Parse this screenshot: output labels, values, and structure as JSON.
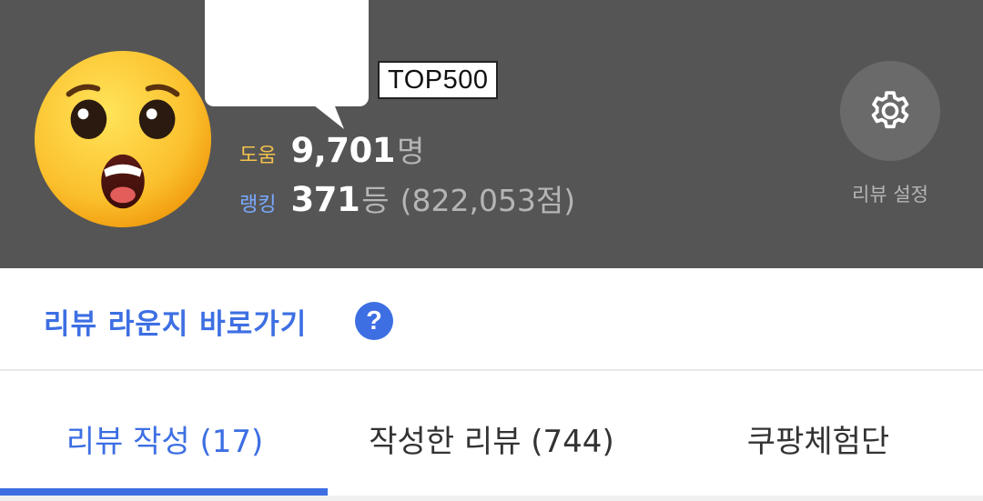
{
  "profile": {
    "badge": "TOP500",
    "help": {
      "label": "도움",
      "value": "9,701",
      "unit": "명"
    },
    "rank": {
      "label": "랭킹",
      "value": "371",
      "unit": "등",
      "score": "(822,053점)"
    },
    "settings": {
      "label": "리뷰 설정",
      "icon": "gear-icon"
    },
    "avatar_icon": "surprised-face-emoji"
  },
  "lounge": {
    "link_label": "리뷰 라운지 바로가기",
    "help_symbol": "?"
  },
  "tabs": [
    {
      "label": "리뷰 작성 (17)",
      "active": true
    },
    {
      "label": "작성한 리뷰 (744)",
      "active": false
    },
    {
      "label": "쿠팡체험단",
      "active": false
    }
  ],
  "colors": {
    "header_bg": "#555555",
    "accent": "#3d6fe3",
    "help_label": "#f3c24c",
    "rank_label": "#7aa9ff"
  }
}
